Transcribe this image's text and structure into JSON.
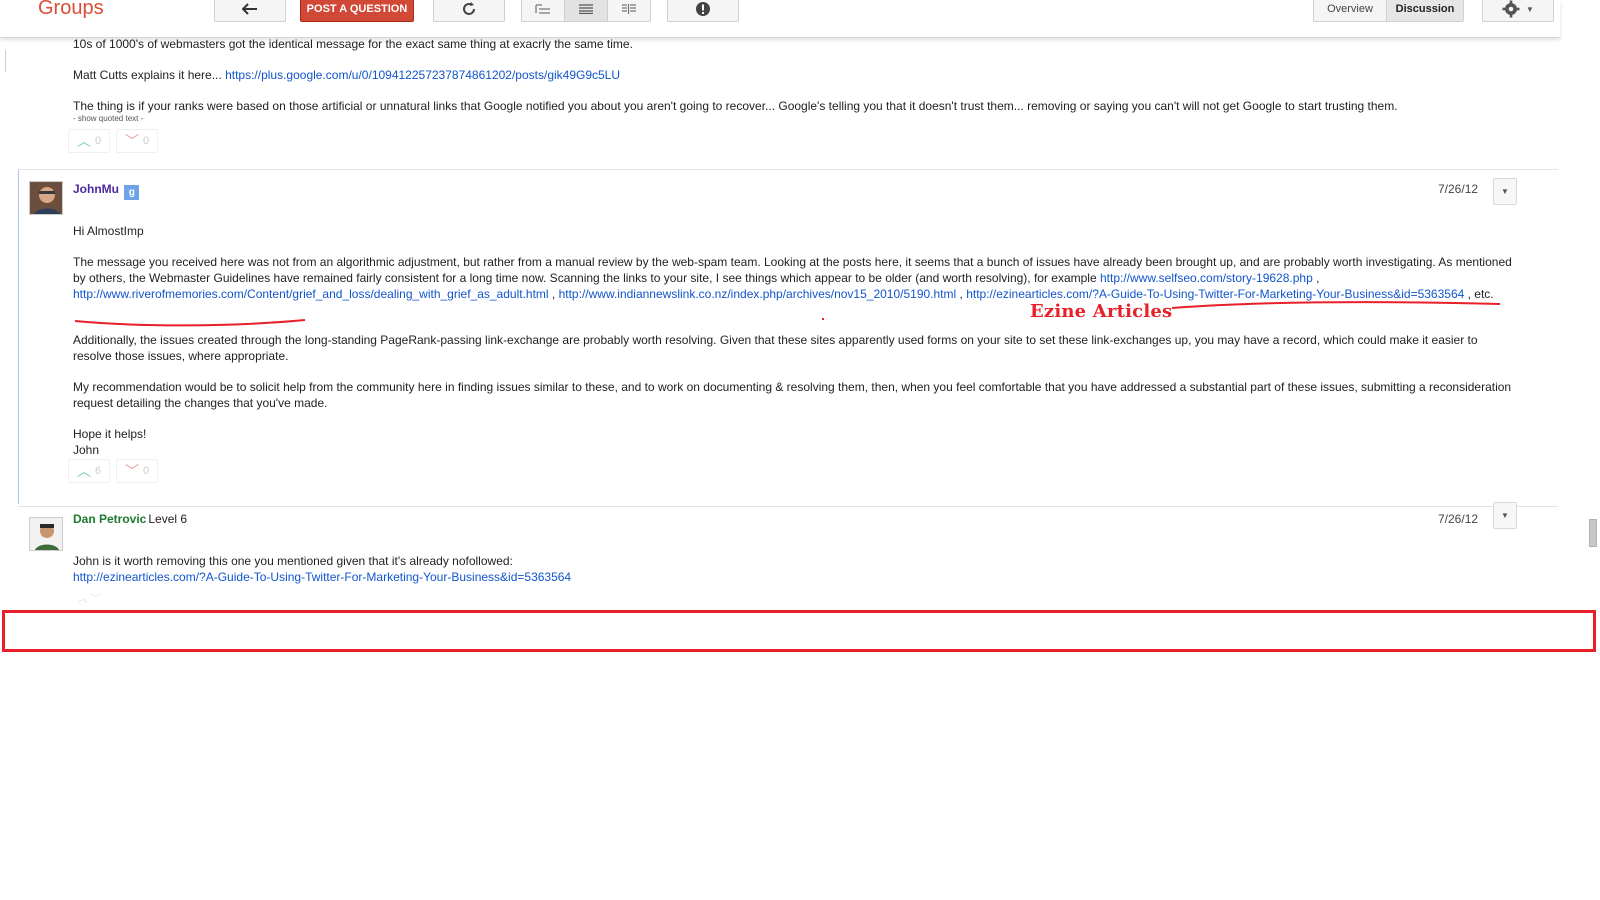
{
  "app": {
    "logo": "Groups"
  },
  "toolbar": {
    "back_icon": "back-arrow-icon",
    "post_question_label": "POST A QUESTION",
    "refresh_icon": "refresh-icon",
    "view_icons": [
      "tree-view-icon",
      "list-view-icon",
      "split-view-icon"
    ],
    "report_icon": "exclamation-icon",
    "tabs": [
      {
        "label": "Overview"
      },
      {
        "label": "Discussion"
      }
    ],
    "settings_icon": "gear-icon"
  },
  "prev_post": {
    "line1": "10s of 1000's of webmasters got the identical message for the exact same thing at exacrly the same time.",
    "line2_prefix": "Matt Cutts explains it here... ",
    "line2_link": "https://plus.google.com/u/0/109412257237874861202/posts/gik49G9c5LU",
    "line3": "The thing is if your ranks were based on those artificial or unnatural links that Google notified you about you aren't going to recover... Google's telling you that it doesn't trust them... removing or saying you can't will not get Google to start trusting them.",
    "show_quoted": "- show quoted text -",
    "upvotes": "0",
    "downvotes": "0"
  },
  "posts": [
    {
      "author": "JohnMu",
      "date": "7/26/12",
      "greeting": "Hi AlmostImp",
      "para1_text": "The message you received here was not from an algorithmic adjustment, but rather from a manual review by the web-spam team. Looking at the posts here, it seems that a bunch of issues have already been brought up, and are probably worth investigating. As mentioned by others, the Webmaster Guidelines have remained fairly consistent for a long time now. Scanning the links to your site, I see things which appear to be older (and worth resolving), for example ",
      "link1": "http://www.selfseo.com/story-19628.php",
      "link2": "http://www.riverofmemories.com/Content/grief_and_loss/dealing_with_grief_as_adult.html",
      "link3": "http://www.indiannewslink.co.nz/index.php/archives/nov15_2010/5190.html",
      "link4": "http://ezinearticles.com/?A-Guide-To-Using-Twitter-For-Marketing-Your-Business&id=5363564",
      "sep": " , ",
      "etc": " ,  etc.",
      "para2": "Additionally, the issues created through the long-standing PageRank-passing link-exchange are probably worth resolving. Given that these sites apparently used forms on your site to set these link-exchanges up, you may have a record, which could make it easier to resolve those issues, where appropriate.",
      "para3": "My recommendation would be to solicit help from the community here in finding issues similar to these, and to work on documenting & resolving them, then, when you feel comfortable that you have addressed a substantial part of these issues, submitting a reconsideration request detailing the changes that you've made.",
      "closing1": "Hope it helps!",
      "closing2": "John",
      "upvotes": "6",
      "downvotes": "0"
    },
    {
      "author": "Dan Petrovic",
      "level": "Level 6",
      "date": "7/26/12",
      "body": "John is it worth removing this one you mentioned given that it's already nofollowed:",
      "link": "http://ezinearticles.com/?A-Guide-To-Using-Twitter-For-Marketing-Your-Business&id=5363564"
    }
  ],
  "annotation": {
    "label": "Ezine Articles",
    "color": "#e8202a"
  },
  "colors": {
    "brand_red": "#dd4b39",
    "link_blue": "#1155cc",
    "author_johnmu": "#4a2aa0",
    "author_dan": "#1e7a2e"
  }
}
